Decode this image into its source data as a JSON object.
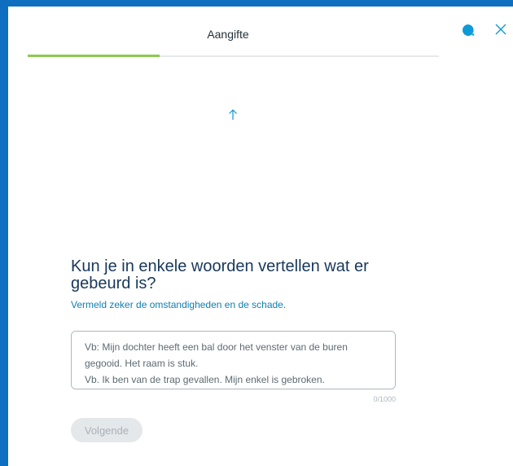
{
  "header": {
    "title": "Aangifte",
    "chat_icon_color": "#0d9ad6",
    "close_icon_color": "#0d9ad6"
  },
  "progress": {
    "value": 0.32,
    "color": "#8ec850"
  },
  "question": {
    "title": "Kun je in enkele woorden vertellen wat er gebeurd is?",
    "hint": "Vermeld zeker de omstandigheden en de schade."
  },
  "input": {
    "value": "",
    "placeholder": "Vb: Mijn dochter heeft een bal door het venster van de buren gegooid. Het raam is stuk.\nVb. Ik ben van de trap gevallen. Mijn enkel is gebroken.",
    "counter": "0/1000"
  },
  "actions": {
    "next_label": "Volgende"
  },
  "icons": {
    "scroll_up": "arrow-up-icon",
    "chat": "chat-bubble-icon",
    "close": "close-icon"
  }
}
